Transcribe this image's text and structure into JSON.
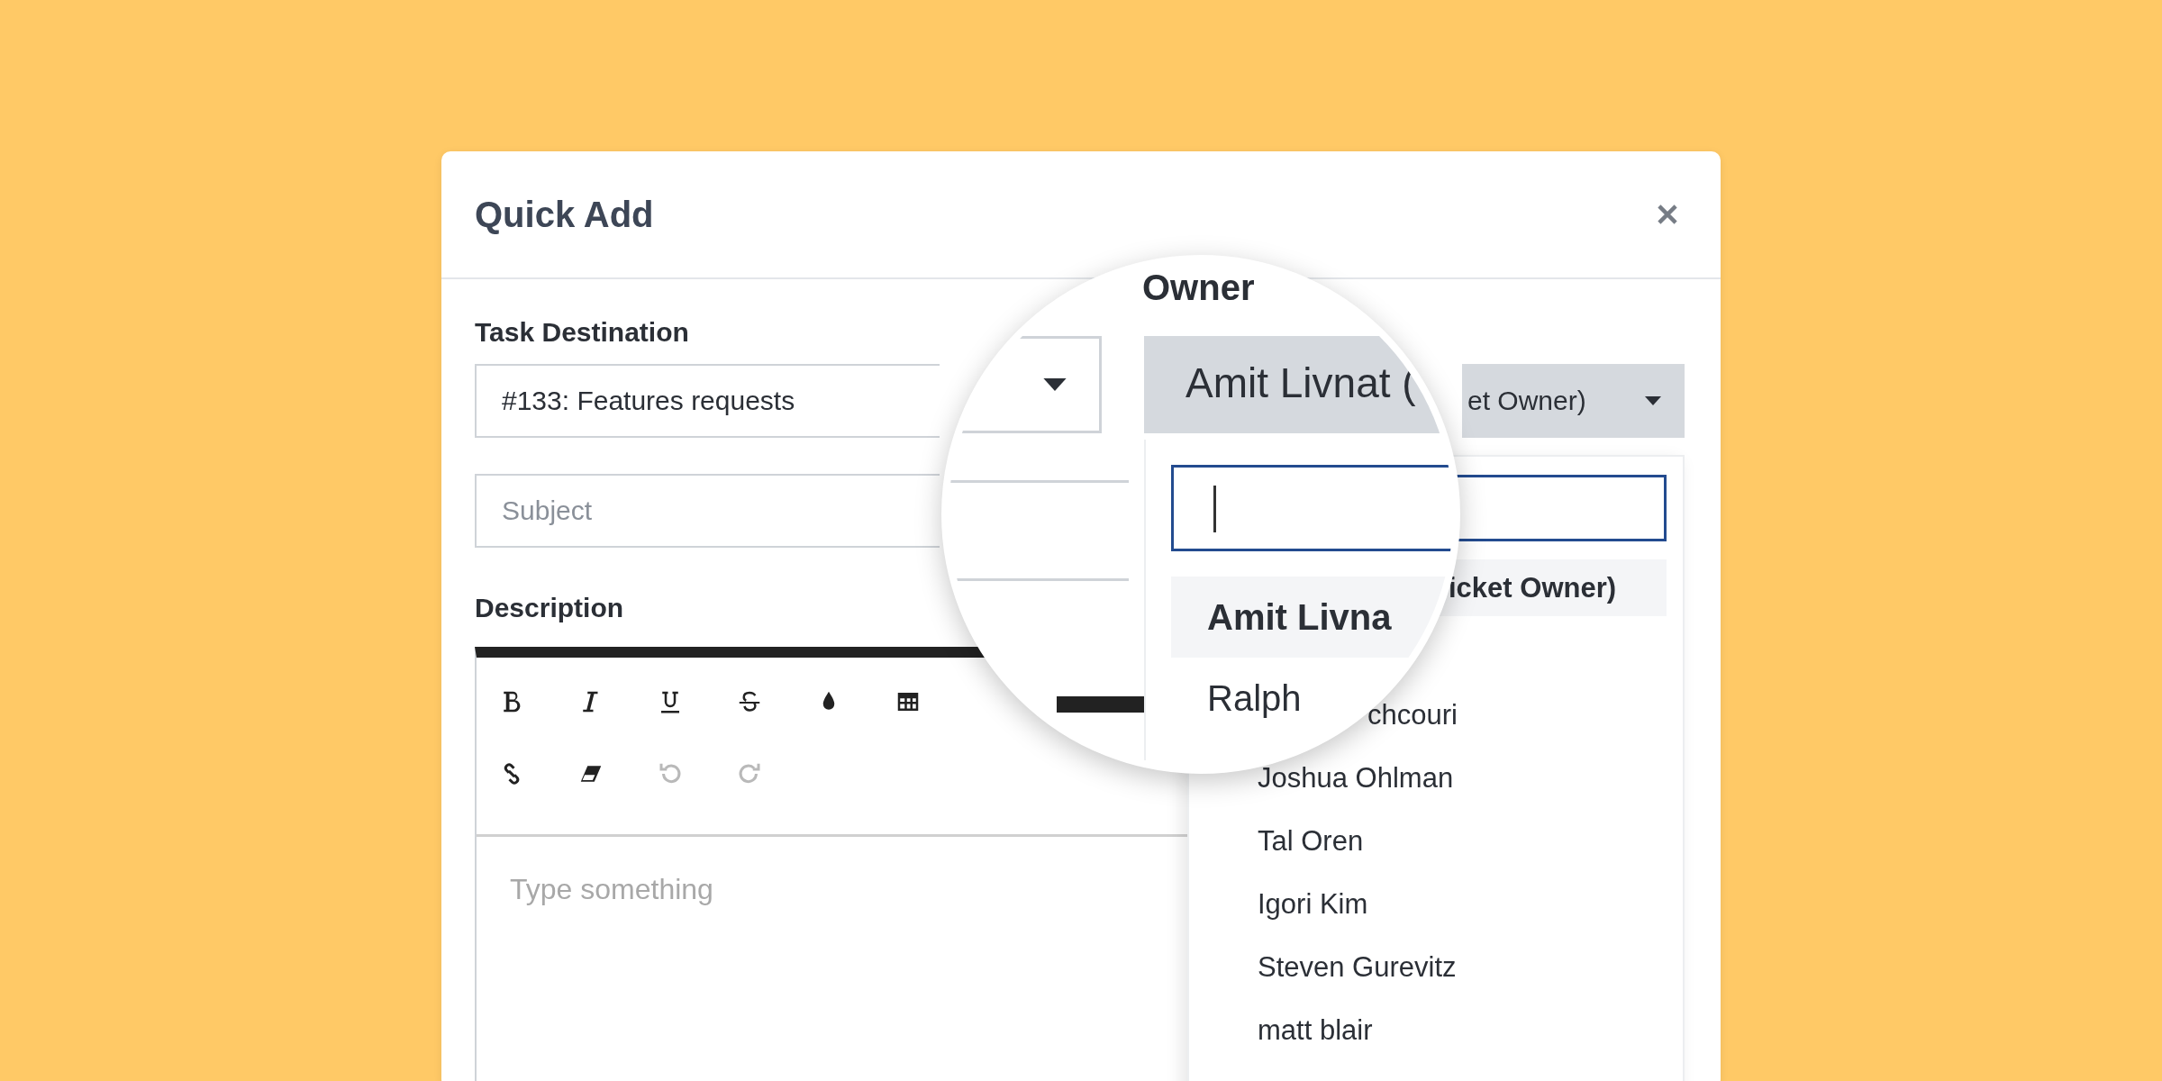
{
  "dialog": {
    "title": "Quick Add"
  },
  "task_destination": {
    "label": "Task Destination",
    "value": "#133: Features requests"
  },
  "subject": {
    "placeholder": "Subject"
  },
  "description": {
    "label": "Description",
    "placeholder": "Type something",
    "toolbar": [
      {
        "kind": "bold",
        "disabled": false
      },
      {
        "kind": "italic",
        "disabled": false
      },
      {
        "kind": "underline",
        "disabled": false
      },
      {
        "kind": "strike",
        "disabled": false
      },
      {
        "kind": "color",
        "disabled": false
      },
      {
        "kind": "table",
        "disabled": false
      },
      {
        "kind": "link",
        "disabled": false
      },
      {
        "kind": "eraser",
        "disabled": false
      },
      {
        "kind": "undo",
        "disabled": true
      },
      {
        "kind": "redo",
        "disabled": true
      }
    ]
  },
  "owner": {
    "value": "et Owner)",
    "items": [
      {
        "name": "icket Owner)",
        "selected": true,
        "kind": "cut"
      },
      {
        "name": "chcouri",
        "selected": false,
        "kind": "cut"
      },
      {
        "name": "Joshua Ohlman",
        "selected": false,
        "kind": "plain"
      },
      {
        "name": "Tal Oren",
        "selected": false,
        "kind": "plain"
      },
      {
        "name": "Igori Kim",
        "selected": false,
        "kind": "plain"
      },
      {
        "name": "Steven Gurevitz",
        "selected": false,
        "kind": "plain"
      },
      {
        "name": "matt blair",
        "selected": false,
        "kind": "plain"
      }
    ]
  },
  "magnifier": {
    "owner_label": "Owner",
    "owner_value": "Amit Livnat (",
    "items": [
      {
        "name": "Amit Livna",
        "selected": true
      },
      {
        "name": "Ralph",
        "selected": false
      }
    ]
  }
}
